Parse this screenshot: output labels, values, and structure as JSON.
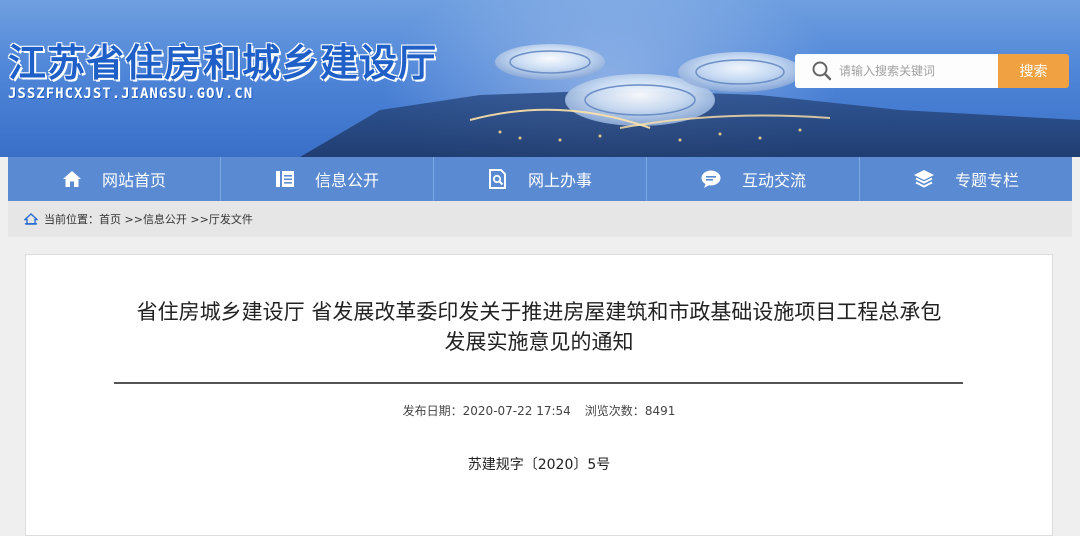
{
  "header": {
    "site_title": "江苏省住房和城乡建设厅",
    "site_url": "JSSZFHCXJST.JIANGSU.GOV.CN",
    "search_placeholder": "请输入搜索关键词",
    "search_button": "搜索"
  },
  "nav": {
    "items": [
      {
        "label": "网站首页",
        "icon": "home-icon"
      },
      {
        "label": "信息公开",
        "icon": "document-list-icon"
      },
      {
        "label": "网上办事",
        "icon": "search-document-icon"
      },
      {
        "label": "互动交流",
        "icon": "chat-bubble-icon"
      },
      {
        "label": "专题专栏",
        "icon": "layers-icon"
      }
    ]
  },
  "breadcrumb": {
    "prefix": "当前位置：",
    "items": [
      "首页",
      "信息公开",
      "厅发文件"
    ],
    "separator": " >>"
  },
  "article": {
    "title_line1": "省住房城乡建设厅 省发展改革委印发关于推进房屋建筑和市政基础设施项目工程总承包",
    "title_line2": "发展实施意见的通知",
    "publish_label": "发布日期：",
    "publish_date": "2020-07-22 17:54",
    "views_label": "浏览次数：",
    "views": "8491",
    "doc_number": "苏建规字〔2020〕5号"
  },
  "colors": {
    "nav_bg": "#5a8ad1",
    "search_button": "#f0a242",
    "title_blue": "#1f5fc8"
  }
}
